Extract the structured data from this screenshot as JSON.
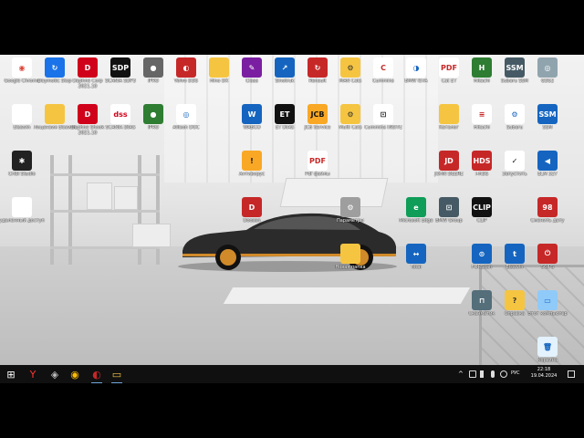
{
  "icons": [
    {
      "label": "Google Chrome",
      "bg": "#ffffff",
      "fg": "#db4437",
      "glyph": "◉",
      "col": 0,
      "row": 0
    },
    {
      "label": "Daymotic Stop",
      "bg": "#1a73e8",
      "fg": "#fff",
      "glyph": "↻",
      "col": 1,
      "row": 0
    },
    {
      "label": "Elsawin",
      "bg": "#ffffff",
      "fg": "#333",
      "glyph": "",
      "col": 0,
      "row": 1
    },
    {
      "label": "Лицензия Elsawin",
      "bg": "#f5c542",
      "fg": "#333",
      "glyph": "",
      "col": 1,
      "row": 1
    },
    {
      "label": "CHSI Studio",
      "bg": "#222",
      "fg": "#fff",
      "glyph": "✱",
      "col": 0,
      "row": 2
    },
    {
      "label": "удаленный доступ",
      "bg": "#ffffff",
      "fg": "#333",
      "glyph": "",
      "col": 0,
      "row": 3
    },
    {
      "label": "Daphne Corp 2021.10",
      "bg": "#d0021b",
      "fg": "#fff",
      "glyph": "D",
      "col": 2,
      "row": 0
    },
    {
      "label": "Daphne Shook 2021.10",
      "bg": "#d0021b",
      "fg": "#fff",
      "glyph": "D",
      "col": 2,
      "row": 1
    },
    {
      "label": "SCANIA SDP3",
      "bg": "#111",
      "fg": "#fff",
      "glyph": "SDP",
      "col": 3,
      "row": 0
    },
    {
      "label": "SCANIA DIAG",
      "bg": "#ffffff",
      "fg": "#d0021b",
      "glyph": "dss",
      "col": 3,
      "row": 1
    },
    {
      "label": "IPRO",
      "bg": "#666",
      "fg": "#fff",
      "glyph": "●",
      "col": 4,
      "row": 0
    },
    {
      "label": "IPRO",
      "bg": "#2e7d32",
      "fg": "#fff",
      "glyph": "●",
      "col": 4,
      "row": 1
    },
    {
      "label": "Volvo DDS",
      "bg": "#c62828",
      "fg": "#fff",
      "glyph": "◐",
      "col": 5,
      "row": 0
    },
    {
      "label": "Allison DOC",
      "bg": "#ffffff",
      "fg": "#1565c0",
      "glyph": "◎",
      "col": 5,
      "row": 1
    },
    {
      "label": "Hino DX",
      "bg": "#f5c542",
      "fg": "#333",
      "glyph": "",
      "col": 6,
      "row": 0
    },
    {
      "label": "Claas",
      "bg": "#7b1fa2",
      "fg": "#fff",
      "glyph": "✎",
      "col": 7,
      "row": 0
    },
    {
      "label": "WABCO",
      "bg": "#1565c0",
      "fg": "#fff",
      "glyph": "W",
      "col": 7,
      "row": 1
    },
    {
      "label": "Sinotruk",
      "bg": "#1565c0",
      "fg": "#fff",
      "glyph": "↗",
      "col": 8,
      "row": 0
    },
    {
      "label": "ET DIAG",
      "bg": "#111",
      "fg": "#fff",
      "glyph": "ET",
      "col": 8,
      "row": 1
    },
    {
      "label": "Renault",
      "bg": "#c62828",
      "fg": "#fff",
      "glyph": "↻",
      "col": 9,
      "row": 0
    },
    {
      "label": "JCB Service",
      "bg": "#f9a825",
      "fg": "#111",
      "glyph": "JCB",
      "col": 9,
      "row": 1
    },
    {
      "label": "MAN Cats",
      "bg": "#f5c542",
      "fg": "#333",
      "glyph": "⚙",
      "col": 10,
      "row": 0
    },
    {
      "label": "Multi Cats",
      "bg": "#f5c542",
      "fg": "#333",
      "glyph": "⚙",
      "col": 10,
      "row": 1
    },
    {
      "label": "Cummins",
      "bg": "#ffffff",
      "fg": "#c62828",
      "glyph": "C",
      "col": 11,
      "row": 0
    },
    {
      "label": "Cummins INSITE",
      "bg": "#ffffff",
      "fg": "#111",
      "glyph": "⊡",
      "col": 11,
      "row": 1
    },
    {
      "label": "BMW ISTA",
      "bg": "#ffffff",
      "fg": "#1565c0",
      "glyph": "◑",
      "col": 12,
      "row": 0
    },
    {
      "label": "Cat ET",
      "bg": "#ffffff",
      "fg": "#c62828",
      "glyph": "PDF",
      "col": 13,
      "row": 0
    },
    {
      "label": "Каталог",
      "bg": "#f5c542",
      "fg": "#333",
      "glyph": "",
      "col": 13,
      "row": 1
    },
    {
      "label": "Hitachi",
      "bg": "#2e7d32",
      "fg": "#fff",
      "glyph": "H",
      "col": 14,
      "row": 0
    },
    {
      "label": "Hitachi",
      "bg": "#ffffff",
      "fg": "#c62828",
      "glyph": "≡",
      "col": 14,
      "row": 1
    },
    {
      "label": "Subaru SSM",
      "bg": "#455a64",
      "fg": "#fff",
      "glyph": "SSM",
      "col": 15,
      "row": 0
    },
    {
      "label": "Subaru",
      "bg": "#ffffff",
      "fg": "#1565c0",
      "glyph": "⚙",
      "col": 15,
      "row": 1
    },
    {
      "label": "GDS2",
      "bg": "#90a4ae",
      "fg": "#fff",
      "glyph": "◎",
      "col": 16,
      "row": 0
    },
    {
      "label": "SSM",
      "bg": "#1565c0",
      "fg": "#fff",
      "glyph": "SSM",
      "col": 16,
      "row": 1
    },
    {
      "label": "Антивирус",
      "bg": "#f9a825",
      "fg": "#111",
      "glyph": "!",
      "col": 7,
      "row": 2
    },
    {
      "label": "Pdf файлы",
      "bg": "#ffffff",
      "fg": "#c62828",
      "glyph": "PDF",
      "col": 9,
      "row": 2
    },
    {
      "label": "Doosan",
      "bg": "#c62828",
      "fg": "#fff",
      "glyph": "D",
      "col": 7,
      "row": 3
    },
    {
      "label": "Параметры",
      "bg": "#9e9e9e",
      "fg": "#fff",
      "glyph": "⚙",
      "col": 10,
      "row": 3
    },
    {
      "label": "Новая папка",
      "bg": "#f5c542",
      "fg": "#333",
      "glyph": "",
      "col": 10,
      "row": 4
    },
    {
      "label": "Microsoft Edge",
      "bg": "#0f9d58",
      "fg": "#fff",
      "glyph": "e",
      "col": 12,
      "row": 3
    },
    {
      "label": "BMW Group",
      "bg": "#455a64",
      "fg": "#fff",
      "glyph": "⊡",
      "col": 13,
      "row": 3
    },
    {
      "label": "Total",
      "bg": "#1565c0",
      "fg": "#fff",
      "glyph": "↔",
      "col": 12,
      "row": 4
    },
    {
      "label": "JOHN DEERE",
      "bg": "#c62828",
      "fg": "#fff",
      "glyph": "JD",
      "col": 13,
      "row": 2
    },
    {
      "label": "I-HDS",
      "bg": "#c62828",
      "fg": "#fff",
      "glyph": "HDS",
      "col": 14,
      "row": 2
    },
    {
      "label": "CLIP",
      "bg": "#111",
      "fg": "#fff",
      "glyph": "CLIP",
      "col": 14,
      "row": 3
    },
    {
      "label": "FORScan",
      "bg": "#1565c0",
      "fg": "#fff",
      "glyph": "⊙",
      "col": 14,
      "row": 4
    },
    {
      "label": "Запустить",
      "bg": "#ffffff",
      "fg": "#111",
      "glyph": "✓",
      "col": 15,
      "row": 2
    },
    {
      "label": "Elsawin",
      "bg": "#1565c0",
      "fg": "#fff",
      "glyph": "t",
      "col": 15,
      "row": 4
    },
    {
      "label": "ELM 327",
      "bg": "#1565c0",
      "fg": "#fff",
      "glyph": "◀",
      "col": 16,
      "row": 2
    },
    {
      "label": "Сменить дату",
      "bg": "#c62828",
      "fg": "#fff",
      "glyph": "98",
      "col": 16,
      "row": 3
    },
    {
      "label": "SCIPS",
      "bg": "#c62828",
      "fg": "#fff",
      "glyph": "⏻",
      "col": 16,
      "row": 4
    },
    {
      "label": "Сканматик",
      "bg": "#546e7a",
      "fg": "#fff",
      "glyph": "⊓",
      "col": 14,
      "row": 5
    },
    {
      "label": "Справка",
      "bg": "#f5c542",
      "fg": "#333",
      "glyph": "?",
      "col": 15,
      "row": 5
    },
    {
      "label": "Этот компьютер",
      "bg": "#90caf9",
      "fg": "#1565c0",
      "glyph": "▭",
      "col": 16,
      "row": 5
    },
    {
      "label": "Корзина",
      "bg": "#e3f2fd",
      "fg": "#1565c0",
      "glyph": "🗑",
      "col": 16,
      "row": 6
    }
  ],
  "taskbar": {
    "items": [
      {
        "name": "start-button",
        "glyph": "⊞",
        "color": "#ffffff"
      },
      {
        "name": "yandex-browser",
        "glyph": "Y",
        "color": "#ff3333"
      },
      {
        "name": "chat-app",
        "glyph": "◈",
        "color": "#bbbbbb"
      },
      {
        "name": "chrome-app",
        "glyph": "◉",
        "color": "#fbbc05"
      },
      {
        "name": "daphne-app",
        "glyph": "◐",
        "color": "#c62828"
      },
      {
        "name": "explorer-app",
        "glyph": "▭",
        "color": "#f5c542"
      }
    ],
    "lang": "РУС",
    "time": "22:18",
    "date": "19.04.2024"
  }
}
